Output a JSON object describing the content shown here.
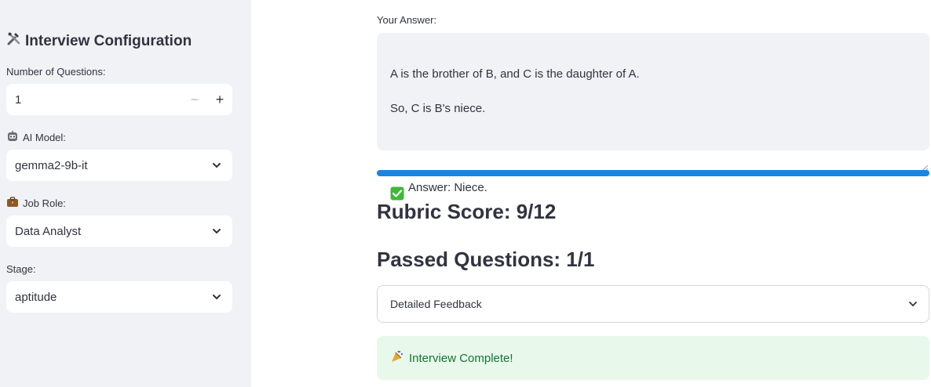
{
  "sidebar": {
    "title": "Interview Configuration",
    "title_icon": "tools-icon",
    "num_questions": {
      "label": "Number of Questions:",
      "value": "1",
      "minus": "−",
      "plus": "+"
    },
    "ai_model": {
      "label": "AI Model:",
      "icon": "robot-icon",
      "value": "gemma2-9b-it"
    },
    "job_role": {
      "label": "Job Role:",
      "icon": "briefcase-icon",
      "value": "Data Analyst"
    },
    "stage": {
      "label": "Stage:",
      "value": "aptitude"
    }
  },
  "main": {
    "answer_label": "Your Answer:",
    "answer_line1": "A is the brother of B, and C is the daughter of A.",
    "answer_line2": "So, C is B's niece.",
    "answer_line3": "Answer: Niece.",
    "progress_fraction": 1.0,
    "rubric_score": "Rubric Score: 9/12",
    "passed_questions": "Passed Questions: 1/1",
    "feedback_expander": "Detailed Feedback",
    "complete_message": "Interview Complete!"
  },
  "colors": {
    "accent": "#1c83e1",
    "sidebar_bg": "#f0f2f6",
    "success_bg": "#e8f9ec",
    "success_text": "#177233"
  }
}
